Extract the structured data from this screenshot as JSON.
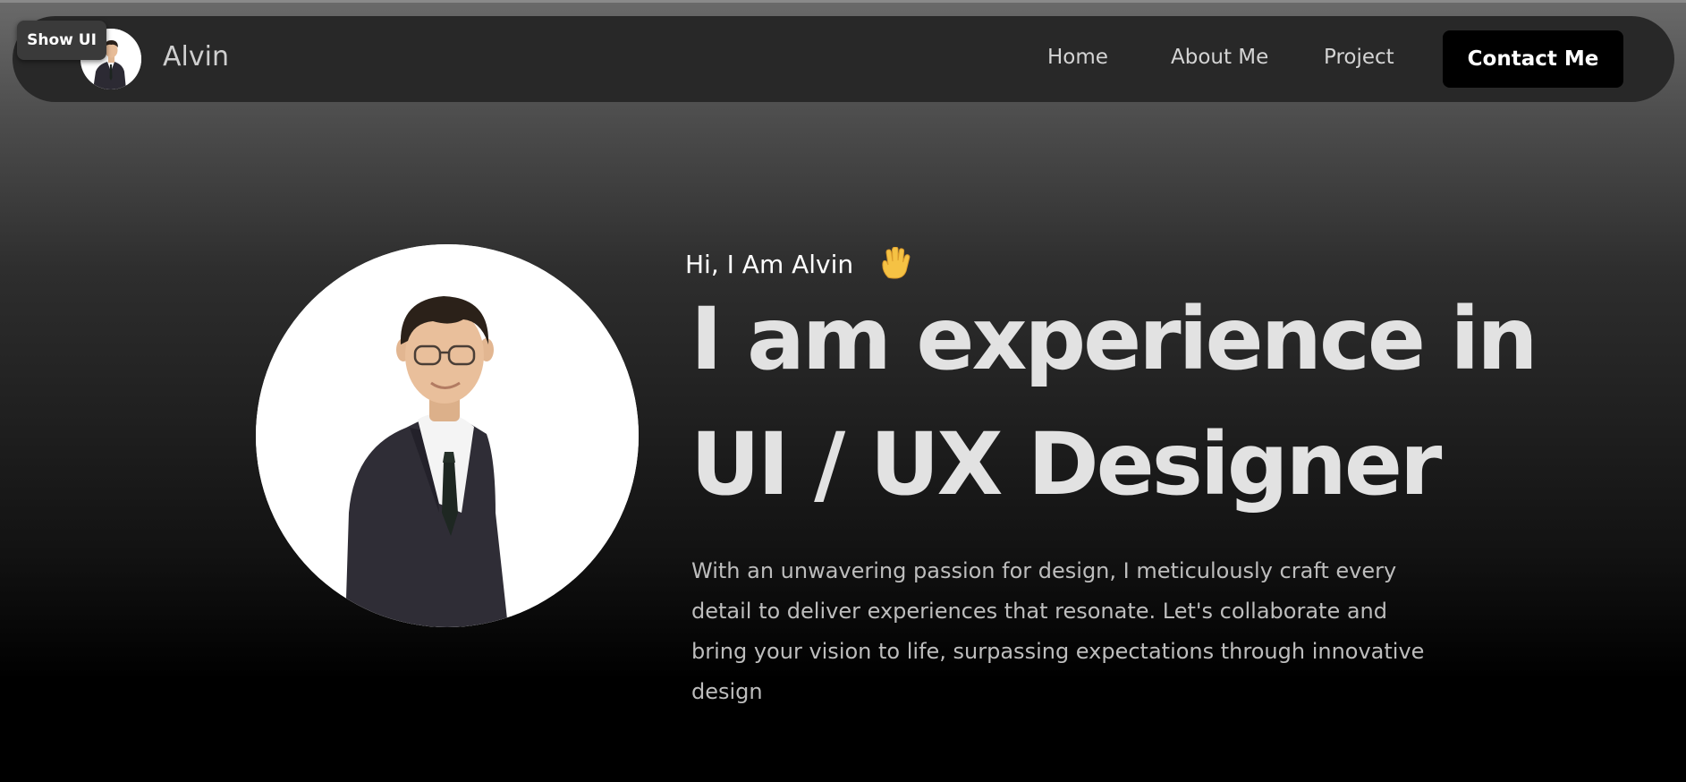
{
  "overlay": {
    "show_ui_label": "Show UI"
  },
  "navbar": {
    "brand_name": "Alvin",
    "links": [
      {
        "label": "Home"
      },
      {
        "label": "About Me"
      },
      {
        "label": "Project"
      }
    ],
    "cta_label": "Contact Me"
  },
  "hero": {
    "greeting": "Hi, I Am Alvin",
    "wave_icon": "waving-hand-icon",
    "headline_line1": "I am experience in",
    "headline_line2": "UI / UX Designer",
    "bio": "With an unwavering passion for design, I meticulously craft every detail to deliver experiences that resonate. Let's collaborate and bring your vision to life, surpassing expectations through innovative design"
  },
  "colors": {
    "background_top": "#6a6a6a",
    "background_bottom": "#000000",
    "navbar_bg": "#282828",
    "cta_bg": "#000000",
    "headline": "#e2e2e2",
    "body_text": "#bdbdbd",
    "wave_emoji": "#f5c244"
  }
}
